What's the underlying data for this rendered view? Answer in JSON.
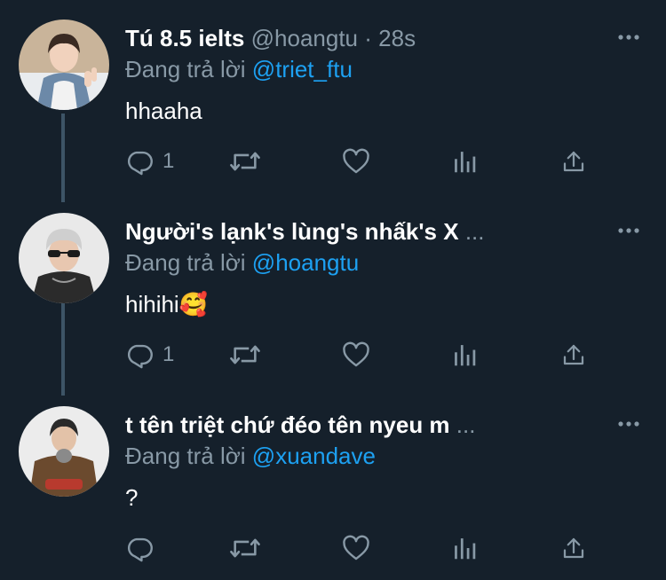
{
  "tweets": [
    {
      "display_name": "Tú 8.5 ielts",
      "handle": "@hoangtu",
      "separator": "·",
      "time": "28s",
      "ellipsis": "",
      "replying_prefix": "Đang trả lời",
      "replying_to": "@triet_ftu",
      "text": "hhaaha",
      "reply_count": "1",
      "avatar_icon": "avatar-photo-1"
    },
    {
      "display_name": "Người's lạnk's lùng's nhấk's X",
      "handle": "",
      "separator": "",
      "time": "",
      "ellipsis": "...",
      "replying_prefix": "Đang trả lời",
      "replying_to": "@hoangtu",
      "text": "hihihi🥰",
      "reply_count": "1",
      "avatar_icon": "avatar-photo-2"
    },
    {
      "display_name": "t tên triệt chứ đéo tên nyeu m",
      "handle": "",
      "separator": "",
      "time": "",
      "ellipsis": "...",
      "replying_prefix": "Đang trả lời",
      "replying_to": "@xuandave",
      "text": "?",
      "reply_count": "",
      "avatar_icon": "avatar-photo-3"
    }
  ],
  "colors": {
    "background": "#15202b",
    "secondary_text": "#8899a6",
    "accent": "#1da1f2",
    "thread_line": "#3d5466"
  },
  "icons": {
    "more": "more-horizontal-icon",
    "reply": "reply-icon",
    "retweet": "retweet-icon",
    "like": "heart-icon",
    "stats": "bar-chart-icon",
    "share": "share-icon"
  }
}
